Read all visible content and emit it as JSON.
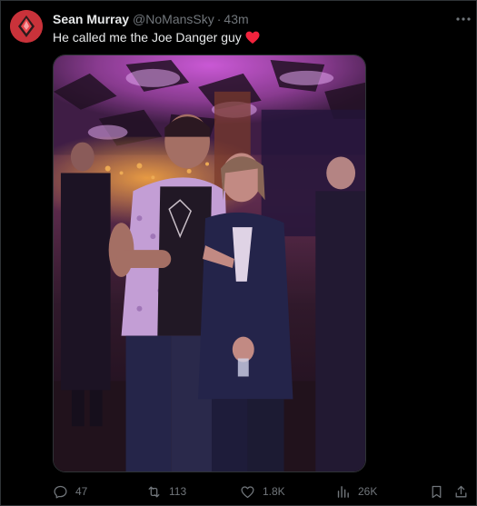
{
  "tweet": {
    "author_name": "Sean Murray",
    "handle": "@NoMansSky",
    "separator": "·",
    "time": "43m",
    "text": "He called me the Joe Danger guy",
    "emoji": "heart-emoji"
  },
  "actions": {
    "replies": "47",
    "reposts": "113",
    "likes": "1.8K",
    "views": "26K"
  },
  "icons": {
    "more": "more-dots-icon",
    "reply": "reply-icon",
    "repost": "repost-icon",
    "like": "heart-icon",
    "views": "views-icon",
    "bookmark": "bookmark-icon",
    "share": "share-icon"
  },
  "colors": {
    "background": "#000000",
    "primary_text": "#e7e9ea",
    "secondary_text": "#71767b",
    "border": "#2f3336",
    "heart": "#f91880",
    "avatar_bg": "#d9343b"
  }
}
